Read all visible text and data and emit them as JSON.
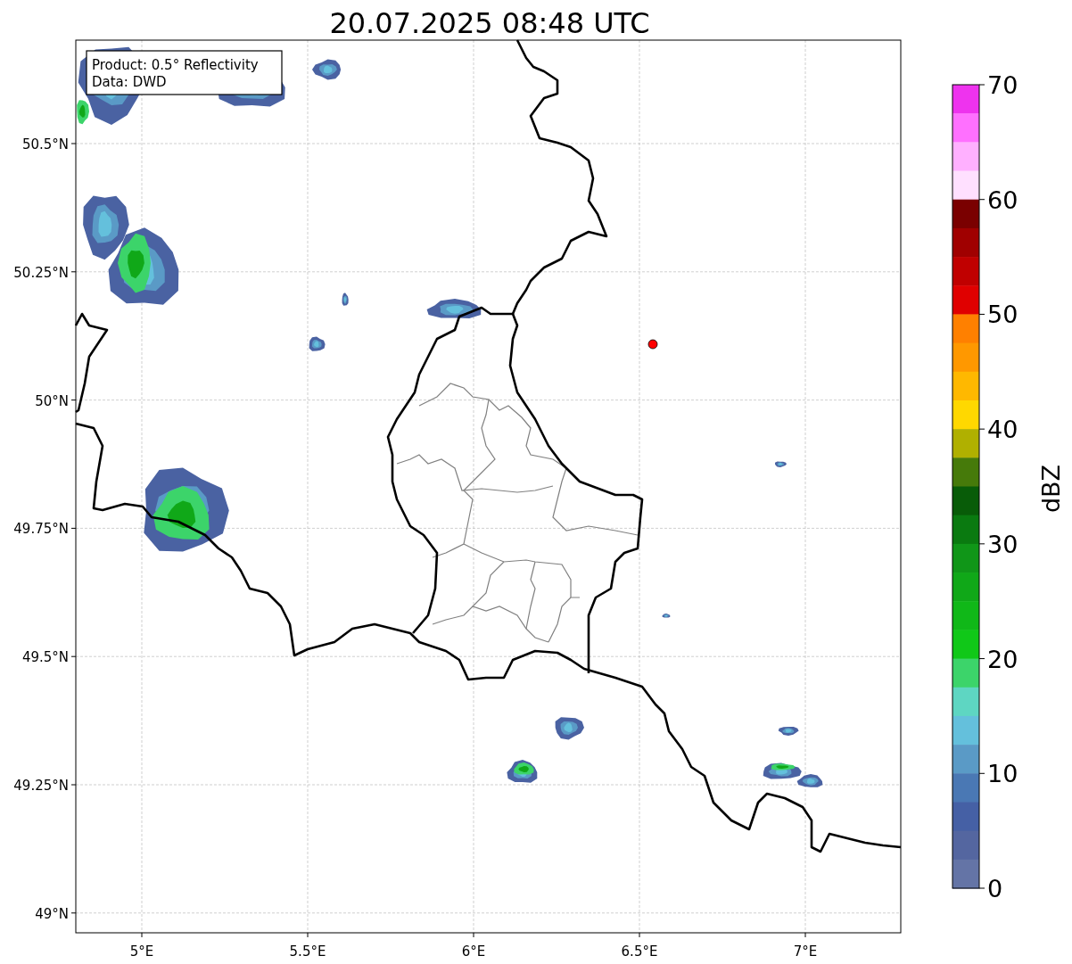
{
  "title": "20.07.2025 08:48 UTC",
  "map": {
    "info_box": [
      "Product: 0.5° Reflectivity",
      "Data: DWD"
    ],
    "xticks": [
      "5°E",
      "5.5°E",
      "6°E",
      "6.5°E",
      "7°E"
    ],
    "yticks": [
      "50.5°N",
      "50.25°N",
      "50°N",
      "49.75°N",
      "49.5°N",
      "49.25°N",
      "49°N"
    ]
  },
  "colorbar": {
    "label": "dBZ",
    "ticks": [
      "70",
      "60",
      "50",
      "40",
      "30",
      "20",
      "10",
      "0"
    ],
    "bands": [
      {
        "color": "#ee33ee"
      },
      {
        "color": "#ff70ff"
      },
      {
        "color": "#ffb0ff"
      },
      {
        "color": "#ffe0ff"
      },
      {
        "color": "#7a0000"
      },
      {
        "color": "#a00000"
      },
      {
        "color": "#c00000"
      },
      {
        "color": "#e00000"
      },
      {
        "color": "#ff8000"
      },
      {
        "color": "#ff9800"
      },
      {
        "color": "#ffb800"
      },
      {
        "color": "#ffd800"
      },
      {
        "color": "#b0b000"
      },
      {
        "color": "#467a0a"
      },
      {
        "color": "#085c08"
      },
      {
        "color": "#0a7a10"
      },
      {
        "color": "#109618"
      },
      {
        "color": "#10a818"
      },
      {
        "color": "#10b818"
      },
      {
        "color": "#10c818"
      },
      {
        "color": "#3cd46a"
      },
      {
        "color": "#5ed6c2"
      },
      {
        "color": "#64c0dc"
      },
      {
        "color": "#5a9ac6"
      },
      {
        "color": "#4a78b4"
      },
      {
        "color": "#4560a5"
      },
      {
        "color": "#5466a0"
      },
      {
        "color": "#6474a6"
      }
    ]
  }
}
